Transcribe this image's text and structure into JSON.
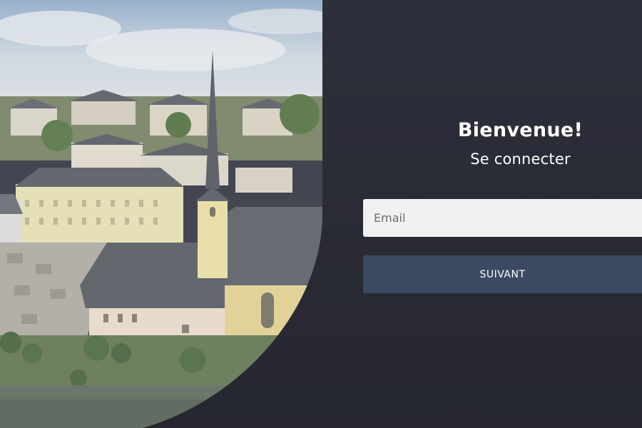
{
  "login": {
    "welcome": "Bienvenue!",
    "subtitle": "Se connecter",
    "email_placeholder": "Email",
    "email_value": "",
    "submit_label": "SUIVANT"
  },
  "colors": {
    "panel": "#2a2c38",
    "button": "#3b4a62",
    "input_bg": "#f1f1f1"
  }
}
